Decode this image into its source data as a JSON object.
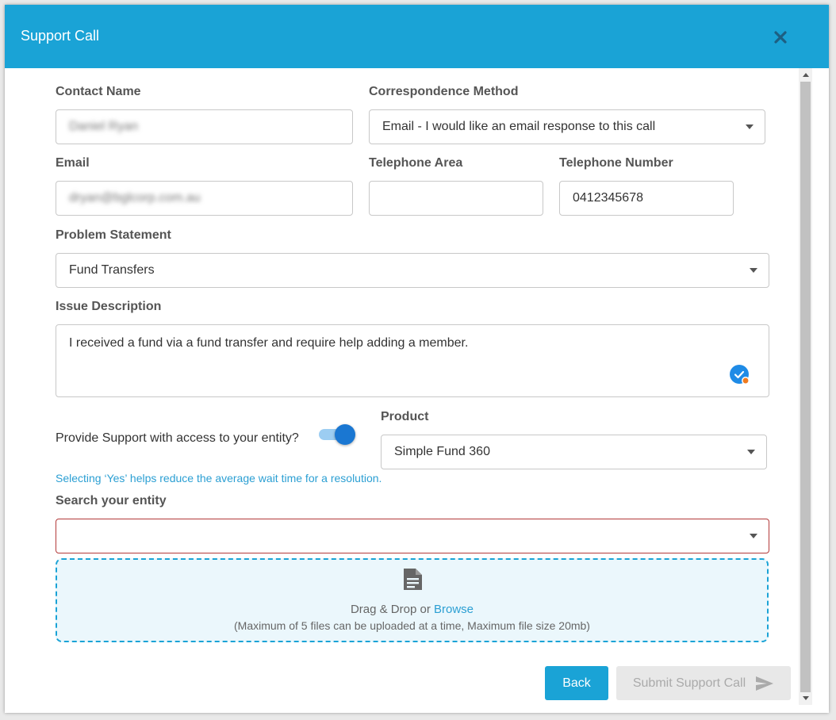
{
  "modal": {
    "title": "Support Call"
  },
  "form": {
    "contact_name": {
      "label": "Contact Name",
      "value": "Daniel Ryan"
    },
    "correspondence_method": {
      "label": "Correspondence Method",
      "value": "Email - I would like an email response to this call"
    },
    "email": {
      "label": "Email",
      "value": "dryan@bglcorp.com.au"
    },
    "telephone_area": {
      "label": "Telephone Area",
      "value": ""
    },
    "telephone_number": {
      "label": "Telephone Number",
      "value": "0412345678"
    },
    "problem_statement": {
      "label": "Problem Statement",
      "value": "Fund Transfers"
    },
    "issue_description": {
      "label": "Issue Description",
      "value": "I received a fund via a fund transfer and require help adding a member."
    },
    "support_access": {
      "label": "Provide Support with access to your entity?",
      "enabled": true,
      "hint": "Selecting ‘Yes’ helps reduce the average wait time for a resolution."
    },
    "product": {
      "label": "Product",
      "value": "Simple Fund 360"
    },
    "search_entity": {
      "label": "Search your entity",
      "value": ""
    }
  },
  "upload": {
    "drag_text": "Drag & Drop or ",
    "browse_link": "Browse",
    "limits": "(Maximum of 5 files can be uploaded at a time, Maximum file size 20mb)"
  },
  "buttons": {
    "back": "Back",
    "submit": "Submit Support Call"
  },
  "colors": {
    "header": "#1aa3d6",
    "toggle_on": "#1a77d2",
    "error_border": "#b33a3a",
    "link": "#2b9fd3"
  }
}
